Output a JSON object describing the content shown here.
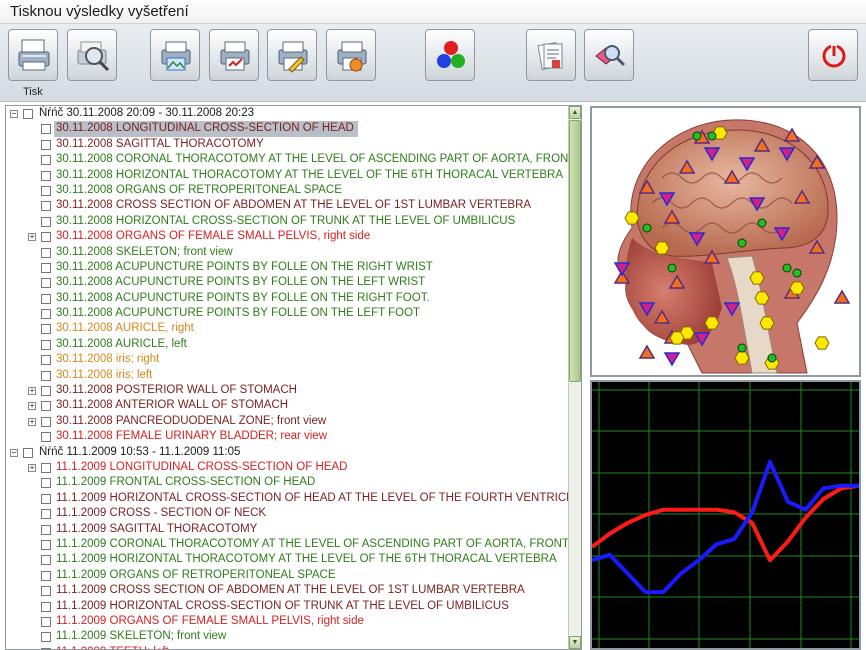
{
  "window": {
    "title": "Tisknou výsledky vyšetření"
  },
  "toolbar": {
    "print_label": "Tisk",
    "buttons": [
      "print-icon",
      "print-preview-icon",
      "print-image-icon",
      "print-chart-icon",
      "print-edit-icon",
      "print-report-icon",
      "color-spheres-icon",
      "notes-icon",
      "magnifier-icon",
      "power-icon"
    ]
  },
  "tree": {
    "rows": [
      {
        "kind": "session",
        "expanded": true,
        "label": "Ńŕńč  30.11.2008 20:09 - 30.11.2008 20:23"
      },
      {
        "kind": "item",
        "date": "30.11.2008",
        "name": "LONGITUDINAL CROSS-SECTION OF HEAD",
        "color": "dark",
        "selected": true
      },
      {
        "kind": "item",
        "date": "30.11.2008",
        "name": "SAGITTAL THORACOTOMY",
        "color": "dark"
      },
      {
        "kind": "item",
        "date": "30.11.2008",
        "name": "CORONAL THORACOTOMY AT THE LEVEL OF ASCENDING PART OF AORTA, FRONT VIEW",
        "color": "green"
      },
      {
        "kind": "item",
        "date": "30.11.2008",
        "name": "HORIZONTAL THORACOTOMY AT THE LEVEL OF THE 6TH THORACAL VERTEBRA",
        "color": "green"
      },
      {
        "kind": "item",
        "date": "30.11.2008",
        "name": "ORGANS OF RETROPERITONEAL SPACE",
        "color": "green"
      },
      {
        "kind": "item",
        "date": "30.11.2008",
        "name": "CROSS SECTION OF ABDOMEN AT THE LEVEL OF 1ST LUMBAR VERTEBRA",
        "color": "dark"
      },
      {
        "kind": "item",
        "date": "30.11.2008",
        "name": "HORIZONTAL CROSS-SECTION OF TRUNK AT THE LEVEL OF UMBILICUS",
        "color": "green"
      },
      {
        "kind": "item",
        "date": "30.11.2008",
        "name": "ORGANS OF FEMALE SMALL PELVIS, right side",
        "color": "red",
        "expandable": true
      },
      {
        "kind": "item",
        "date": "30.11.2008",
        "name": "SKELETON; front view",
        "color": "green"
      },
      {
        "kind": "item",
        "date": "30.11.2008",
        "name": "ACUPUNCTURE POINTS BY FOLLE ON THE RIGHT WRIST",
        "color": "green"
      },
      {
        "kind": "item",
        "date": "30.11.2008",
        "name": "ACUPUNCTURE POINTS BY FOLLE ON THE LEFT WRIST",
        "color": "green"
      },
      {
        "kind": "item",
        "date": "30.11.2008",
        "name": "ACUPUNCTURE POINTS BY FOLLE ON THE RIGHT FOOT.",
        "color": "green"
      },
      {
        "kind": "item",
        "date": "30.11.2008",
        "name": "ACUPUNCTURE POINTS BY FOLLE ON THE LEFT FOOT",
        "color": "green"
      },
      {
        "kind": "item",
        "date": "30.11.2008",
        "name": "AURICLE, right",
        "color": "orange"
      },
      {
        "kind": "item",
        "date": "30.11.2008",
        "name": "AURICLE, left",
        "color": "green"
      },
      {
        "kind": "item",
        "date": "30.11.2008",
        "name": "iris; right",
        "color": "orange"
      },
      {
        "kind": "item",
        "date": "30.11.2008",
        "name": "iris; left",
        "color": "orange"
      },
      {
        "kind": "item",
        "date": "30.11.2008",
        "name": "POSTERIOR WALL OF STOMACH",
        "color": "dark",
        "expandable": true
      },
      {
        "kind": "item",
        "date": "30.11.2008",
        "name": "ANTERIOR  WALL  OF  STOMACH",
        "color": "dark",
        "expandable": true
      },
      {
        "kind": "item",
        "date": "30.11.2008",
        "name": "PANCREODUODENAL ZONE; front view",
        "color": "dark",
        "expandable": true
      },
      {
        "kind": "item",
        "date": "30.11.2008",
        "name": "FEMALE URINARY BLADDER; rear view",
        "color": "red"
      },
      {
        "kind": "session",
        "expanded": true,
        "label": "Ńŕńč  11.1.2009 10:53 - 11.1.2009 11:05"
      },
      {
        "kind": "item",
        "date": "11.1.2009",
        "name": "LONGITUDINAL CROSS-SECTION OF HEAD",
        "color": "red",
        "expandable": true
      },
      {
        "kind": "item",
        "date": "11.1.2009",
        "name": "FRONTAL CROSS-SECTION OF HEAD",
        "color": "green"
      },
      {
        "kind": "item",
        "date": "11.1.2009",
        "name": "HORIZONTAL CROSS-SECTION OF HEAD AT THE LEVEL OF THE FOURTH VENTRICLE",
        "color": "dark"
      },
      {
        "kind": "item",
        "date": "11.1.2009",
        "name": "CROSS - SECTION  OF   NECK",
        "color": "dark"
      },
      {
        "kind": "item",
        "date": "11.1.2009",
        "name": "SAGITTAL THORACOTOMY",
        "color": "dark"
      },
      {
        "kind": "item",
        "date": "11.1.2009",
        "name": "CORONAL THORACOTOMY AT THE LEVEL OF ASCENDING PART OF AORTA, FRONT VIEW",
        "color": "green"
      },
      {
        "kind": "item",
        "date": "11.1.2009",
        "name": "HORIZONTAL THORACOTOMY AT THE LEVEL OF THE 6TH THORACAL VERTEBRA",
        "color": "green"
      },
      {
        "kind": "item",
        "date": "11.1.2009",
        "name": "ORGANS OF RETROPERITONEAL SPACE",
        "color": "green"
      },
      {
        "kind": "item",
        "date": "11.1.2009",
        "name": "CROSS SECTION OF ABDOMEN AT THE LEVEL OF 1ST LUMBAR VERTEBRA",
        "color": "dark"
      },
      {
        "kind": "item",
        "date": "11.1.2009",
        "name": "HORIZONTAL CROSS-SECTION OF TRUNK AT THE LEVEL OF UMBILICUS",
        "color": "dark"
      },
      {
        "kind": "item",
        "date": "11.1.2009",
        "name": "ORGANS OF FEMALE SMALL PELVIS, right side",
        "color": "red"
      },
      {
        "kind": "item",
        "date": "11.1.2009",
        "name": "SKELETON; front view",
        "color": "green"
      },
      {
        "kind": "item",
        "date": "11.1.2009",
        "name": "TEETH; left",
        "color": "red"
      }
    ]
  },
  "colors": {
    "dark": "#7a1f1f",
    "green": "#2e7d1a",
    "red": "#d42020",
    "orange": "#d7871d",
    "selection": "#b8bfc7",
    "graph_blue": "#1a1aff",
    "graph_red": "#ff1a1a",
    "graph_grid": "#1f8a1f"
  },
  "graph": {
    "series": [
      {
        "color": "graph_red",
        "values": [
          0.38,
          0.43,
          0.47,
          0.5,
          0.52,
          0.52,
          0.52,
          0.52,
          0.51,
          0.47,
          0.33,
          0.4,
          0.49,
          0.56,
          0.6,
          0.61
        ]
      },
      {
        "color": "graph_blue",
        "values": [
          0.33,
          0.35,
          0.28,
          0.21,
          0.21,
          0.28,
          0.33,
          0.39,
          0.41,
          0.51,
          0.7,
          0.55,
          0.52,
          0.6,
          0.61,
          0.61
        ]
      }
    ]
  }
}
